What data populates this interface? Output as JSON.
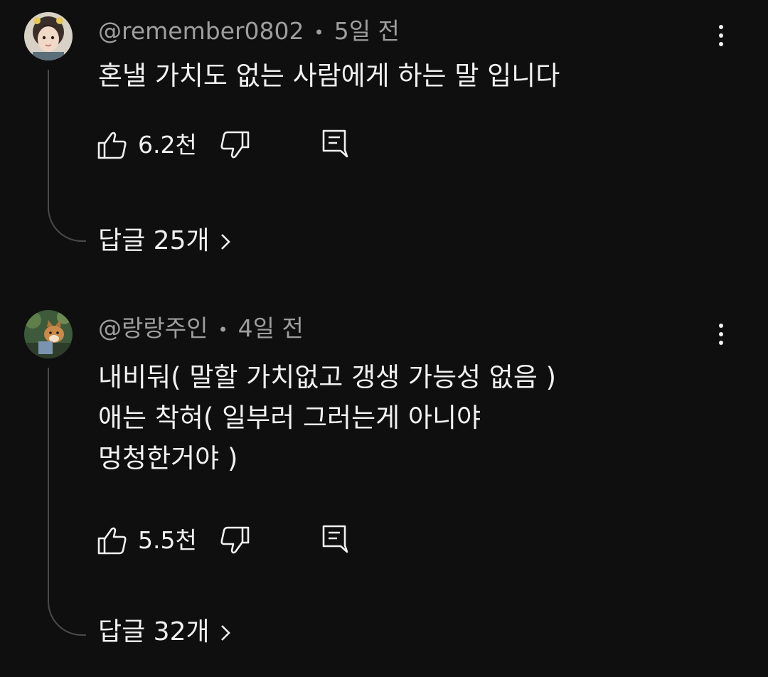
{
  "comments": [
    {
      "author": "@remember0802",
      "time": "5일 전",
      "separator": "•",
      "lines": [
        "혼낼 가치도 없는 사람에게 하는 말 입니다"
      ],
      "likes": "6.2천",
      "replies_label": "답글 25개"
    },
    {
      "author": "@랑랑주인",
      "time": "4일 전",
      "separator": "•",
      "lines": [
        "내비둬( 말할 가치없고 갱생 가능성 없음 )",
        "애는 착혀( 일부러 그러는게 아니야",
        "멍청한거야 )"
      ],
      "likes": "5.5천",
      "replies_label": "답글 32개"
    }
  ],
  "icons": {
    "like": "thumbs-up-icon",
    "dislike": "thumbs-down-icon",
    "reply": "comment-reply-icon",
    "menu": "more-vert-icon",
    "chevron": "chevron-right-icon"
  },
  "colors": {
    "background": "#0f0f0f",
    "text": "#f1f1f1",
    "secondary_text": "#9e9e9e",
    "thread_line": "#4a4a4a"
  }
}
